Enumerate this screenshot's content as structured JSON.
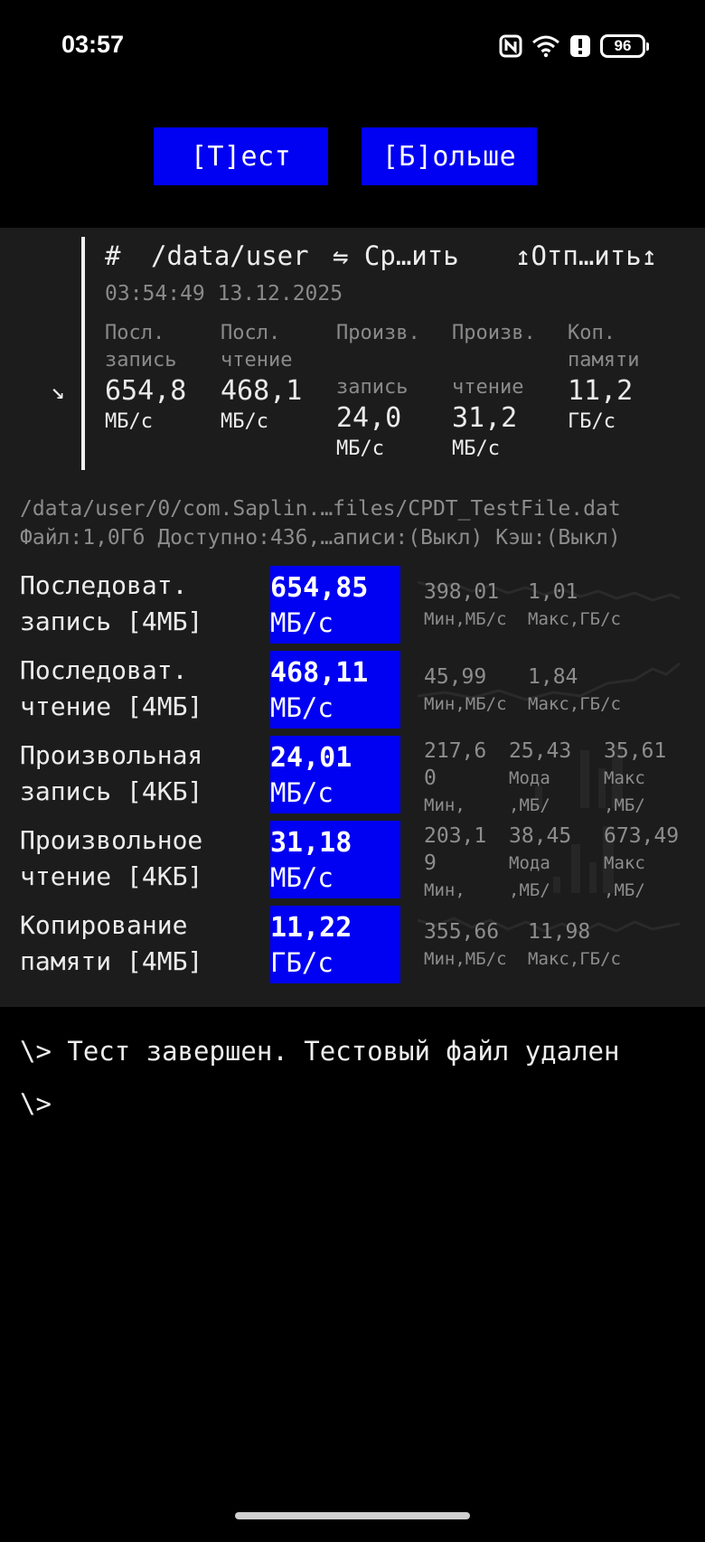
{
  "status_bar": {
    "time": "03:57",
    "icons": [
      "nfc-icon",
      "wifi-icon",
      "alert-icon",
      "battery-icon"
    ],
    "battery": "96"
  },
  "buttons": {
    "test": "[Т]ест",
    "more": "[Б]ольше"
  },
  "summary": {
    "hash": "#",
    "path": "/data/user",
    "compare": "⇋ Ср…ить",
    "send": "↥Отп…ить↥",
    "timestamp": "03:54:49 13.12.2025",
    "arrow": "↘",
    "cols": [
      {
        "l1": "Посл.",
        "l2": "запись",
        "value": "654,8",
        "unit": "МБ/с"
      },
      {
        "l1": "Посл.",
        "l2": "чтение",
        "value": "468,1",
        "unit": "МБ/с"
      },
      {
        "l1": "Произв.",
        "l2": "запись",
        "value": "24,0",
        "unit": "МБ/с"
      },
      {
        "l1": "Произв.",
        "l2": "чтение",
        "value": "31,2",
        "unit": "МБ/с"
      },
      {
        "l1": "Коп.",
        "l2": "памяти",
        "value": "11,2",
        "unit": "ГБ/с"
      }
    ]
  },
  "info": {
    "path": "/data/user/0/com.Saplin.…files/CPDT_TestFile.dat",
    "file": "Файл:1,0Гб Доступно:436,…аписи:(Выкл) Кэш:(Выкл)"
  },
  "results": [
    {
      "name1": "Последоват.",
      "name2": "запись [4МБ]",
      "value": "654,85",
      "unit": "МБ/с",
      "stats": [
        {
          "v": "398,01",
          "l": "Мин,МБ/с"
        },
        {
          "v": "1,01",
          "l": "Макс,ГБ/с"
        }
      ]
    },
    {
      "name1": "Последоват.",
      "name2": "чтение [4МБ]",
      "value": "468,11",
      "unit": "МБ/с",
      "stats": [
        {
          "v": "45,99",
          "l": "Мин,МБ/с"
        },
        {
          "v": "1,84",
          "l": "Макс,ГБ/с"
        }
      ]
    },
    {
      "name1": "Произвольная",
      "name2": "запись [4КБ]",
      "value": "24,01",
      "unit": "МБ/с",
      "stats": [
        {
          "v1": "217,6",
          "v2": "0",
          "l": "Мин,"
        },
        {
          "v1": "25,43",
          "v2": "Мода",
          "l": ",МБ/"
        },
        {
          "v1": "35,61",
          "v2": "Макс",
          "l": ",МБ/"
        }
      ]
    },
    {
      "name1": "Произвольное",
      "name2": "чтение [4КБ]",
      "value": "31,18",
      "unit": "МБ/с",
      "stats": [
        {
          "v1": "203,1",
          "v2": "9",
          "l": "Мин,"
        },
        {
          "v1": "38,45",
          "v2": "Мода",
          "l": ",МБ/"
        },
        {
          "v1": "673,49",
          "v2": "Макс",
          "l": ",МБ/"
        }
      ]
    },
    {
      "name1": "Копирование",
      "name2": "памяти [4МБ]",
      "value": "11,22",
      "unit": "ГБ/с",
      "stats": [
        {
          "v": "355,66",
          "l": "Мин,МБ/с"
        },
        {
          "v": "11,98",
          "l": "Макс,ГБ/с"
        }
      ]
    }
  ],
  "terminal": {
    "line1": "\\> Тест завершен. Тестовый файл удален",
    "line2": "\\>"
  }
}
